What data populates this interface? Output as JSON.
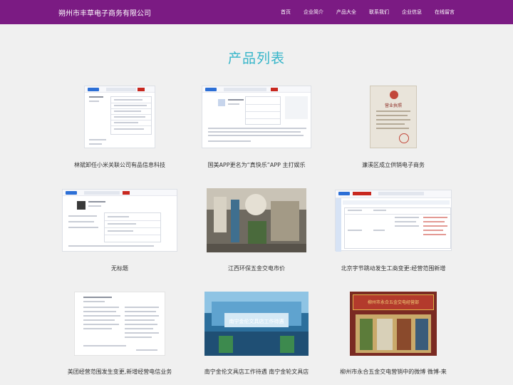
{
  "header": {
    "brand": "朔州市丰草电子商务有限公司",
    "nav": [
      "首页",
      "企业简介",
      "产品大全",
      "联系我们",
      "企业信息",
      "在线留言"
    ]
  },
  "page_title": "产品列表",
  "products": [
    {
      "title": "林斌卸任小米关联公司有品信息科技",
      "image": "company-record-screenshot"
    },
    {
      "title": "国美APP更名为“真快乐”APP 主打娱乐",
      "image": "company-profile-screenshot"
    },
    {
      "title": "濂溪区成立供销电子商务",
      "image": "business-license-photo"
    },
    {
      "title": "无标题",
      "image": "person-profile-screenshot"
    },
    {
      "title": "江西环保五金交电市价",
      "image": "hardware-warehouse-photo"
    },
    {
      "title": "北京字节跳动发生工商变更:经营范围新增",
      "image": "change-record-screenshot"
    },
    {
      "title": "美团经营范围发生变更,新增经营电信业务",
      "image": "document-scan"
    },
    {
      "title": "南宁金伦文具店工作待遇 南宁金轮文具店",
      "image": "office-corridor-photo"
    },
    {
      "title": "柳州市永合五金交电营销中的微博 微博-来",
      "image": "storefront-sign-photo"
    }
  ],
  "overlay_text": "南宁金伦文具店工作待遇",
  "sign_text": "柳州市永合五金交电经营部",
  "license_text": "营业执照",
  "colors": {
    "header_bg": "#7b1b83",
    "title": "#35b5c9",
    "page_bg": "#f0f0f0"
  }
}
